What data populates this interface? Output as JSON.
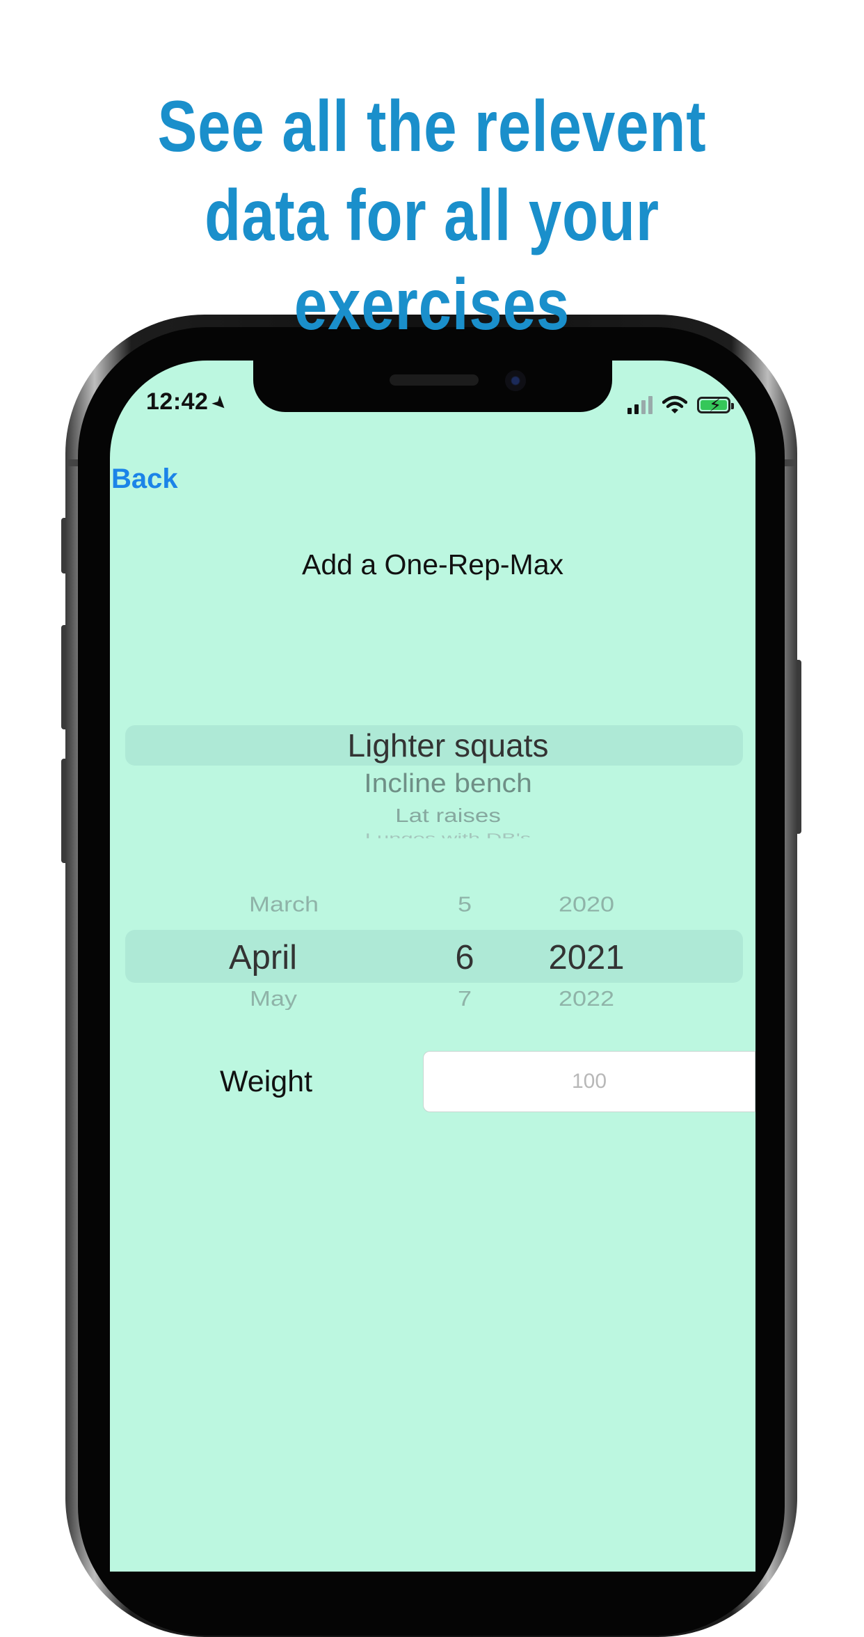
{
  "headline": [
    "See all the relevent",
    "data for all your",
    "exercises"
  ],
  "status_bar": {
    "time": "12:42",
    "location_icon": "location-arrow-icon",
    "battery_state": "charging"
  },
  "nav": {
    "back_label": "Back"
  },
  "screen_title": "Add a One-Rep-Max",
  "exercise_picker": {
    "selected": "Lighter squats",
    "items_below": [
      "Incline bench",
      "Lat raises",
      "Lunges with DB's"
    ]
  },
  "date_picker": {
    "month": {
      "above": "March",
      "selected": "April",
      "below": "May"
    },
    "day": {
      "above": "5",
      "selected": "6",
      "below": "7"
    },
    "year": {
      "above": "2020",
      "selected": "2021",
      "below": "2022"
    }
  },
  "weight": {
    "label": "Weight",
    "placeholder": "100",
    "value": ""
  },
  "colors": {
    "accent": "#1a8fcb",
    "link": "#1b84e8",
    "screen_bg": "#bcf7e0"
  }
}
